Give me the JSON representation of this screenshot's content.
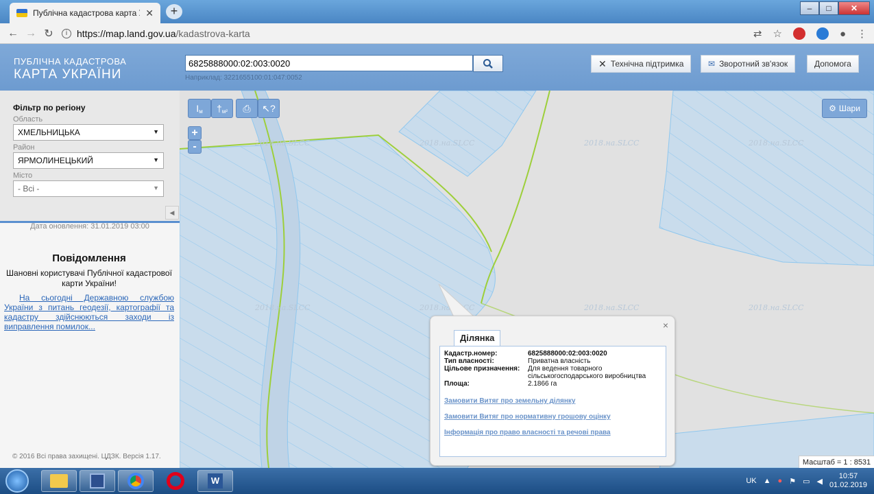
{
  "browser": {
    "tab_title": "Публічна кадастрова карта Укр",
    "url_host": "https://map.land.gov.ua",
    "url_path": "/kadastrova-karta"
  },
  "header": {
    "brand_line1": "ПУБЛІЧНА КАДАСТРОВА",
    "brand_line2": "КАРТА УКРАЇНИ",
    "search_value": "6825888000:02:003:0020",
    "search_hint": "Наприклад: 3221655100:01:047:0052",
    "support_label": "Технічна підтримка",
    "feedback_label": "Зворотний зв'язок",
    "help_label": "Допомога"
  },
  "filter": {
    "title": "Фільтр по регіону",
    "region_label": "Область",
    "region_value": "ХМЕЛЬНИЦЬКА",
    "district_label": "Район",
    "district_value": "ЯРМОЛИНЕЦЬКИЙ",
    "city_label": "Місто",
    "city_value": "- Всі -"
  },
  "sidebar": {
    "updated": "Дата оновлення: 31.01.2019 03:00",
    "notice_title": "Повідомлення",
    "notice_greeting": "Шановні користувачі Публічної кадастрової карти України!",
    "notice_link": "На сьогодні Державною службою України з питань геодезії, картографії та кадастру здійснюються заходи із виправлення помилок...",
    "copyright": "© 2016 Всі права захищені. ЦДЗК. Версія 1.17."
  },
  "map": {
    "layers_label": "Шари",
    "watermark": "2018.на.SLCC",
    "scale": "Масштаб = 1 : 8531",
    "tool_m": "м",
    "tool_m2": "м²",
    "zoom_in": "+",
    "zoom_out": "-"
  },
  "popup": {
    "tab": "Ділянка",
    "close": "×",
    "cadastral_key": "Кадастр.номер:",
    "cadastral_value": "6825888000:02:003:0020",
    "ownership_key": "Тип власності:",
    "ownership_value": "Приватна власність",
    "purpose_key": "Цільове призначення:",
    "purpose_value": "Для ведення товарного сільськогосподарського виробництва",
    "area_key": "Площа:",
    "area_value": "2.1866 га",
    "link1": "Замовити Витяг про земельну ділянку",
    "link2": "Замовити Витяг про нормативну грошову оцінку",
    "link3": "Інформація про право власності та речові права"
  },
  "taskbar": {
    "lang": "UK",
    "time": "10:57",
    "date": "01.02.2019"
  },
  "colors": {
    "parcel_fill": "#c9dcec",
    "parcel_line": "#8fc7ee",
    "green_border": "#9dcf3a",
    "header_blue": "#7fa9d8"
  }
}
